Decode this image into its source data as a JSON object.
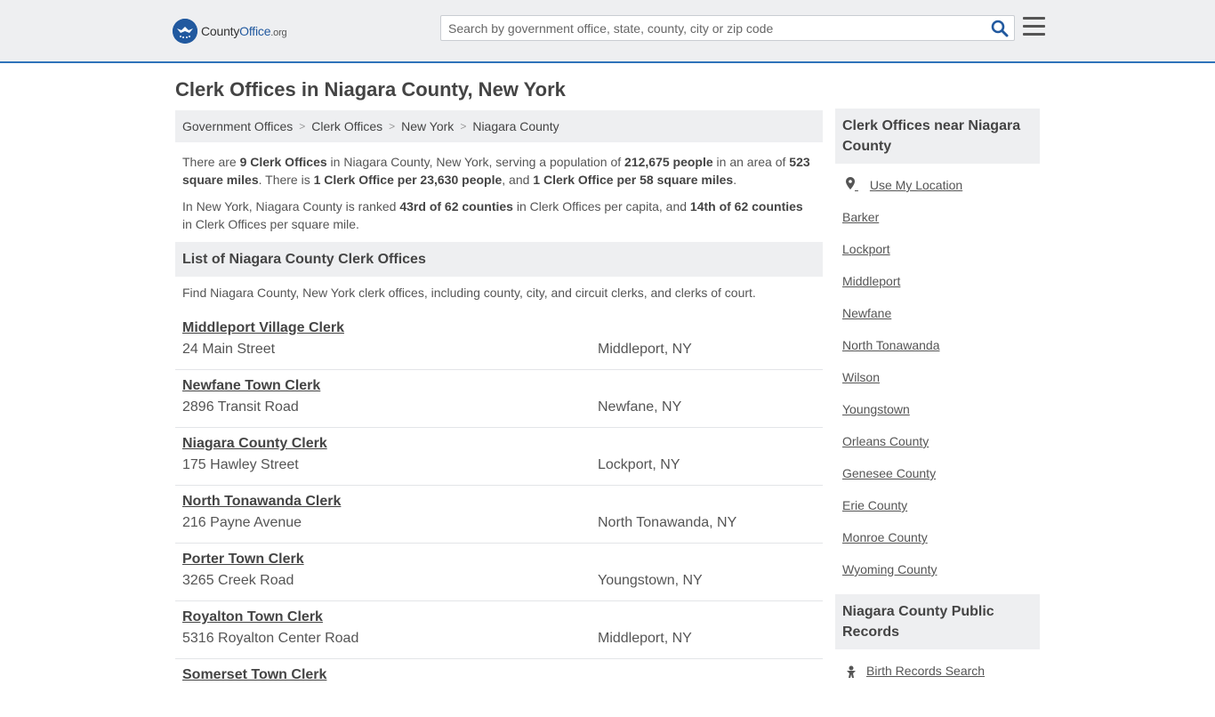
{
  "header": {
    "logo": {
      "brand": "County",
      "brand_accent": "Office",
      "tld": ".org"
    },
    "search": {
      "placeholder": "Search by government office, state, county, city or zip code"
    }
  },
  "page_title": "Clerk Offices in Niagara County, New York",
  "breadcrumb": [
    "Government Offices",
    "Clerk Offices",
    "New York",
    "Niagara County"
  ],
  "intro": {
    "p1": {
      "t1": "There are ",
      "b1": "9 Clerk Offices",
      "t2": " in Niagara County, New York, serving a population of ",
      "b2": "212,675 people",
      "t3": " in an area of ",
      "b3": "523 square miles",
      "t4": ". There is ",
      "b4": "1 Clerk Office per 23,630 people",
      "t5": ", and ",
      "b5": "1 Clerk Office per 58 square miles",
      "t6": "."
    },
    "p2": {
      "t1": "In New York, Niagara County is ranked ",
      "b1": "43rd of 62 counties",
      "t2": " in Clerk Offices per capita, and ",
      "b2": "14th of 62 counties",
      "t3": " in Clerk Offices per square mile."
    }
  },
  "list": {
    "heading": "List of Niagara County Clerk Offices",
    "description": "Find Niagara County, New York clerk offices, including county, city, and circuit clerks, and clerks of court.",
    "offices": [
      {
        "name": "Middleport Village Clerk",
        "address": "24 Main Street",
        "city": "Middleport, NY"
      },
      {
        "name": "Newfane Town Clerk",
        "address": "2896 Transit Road",
        "city": "Newfane, NY"
      },
      {
        "name": "Niagara County Clerk",
        "address": "175 Hawley Street",
        "city": "Lockport, NY"
      },
      {
        "name": "North Tonawanda Clerk",
        "address": "216 Payne Avenue",
        "city": "North Tonawanda, NY"
      },
      {
        "name": "Porter Town Clerk",
        "address": "3265 Creek Road",
        "city": "Youngstown, NY"
      },
      {
        "name": "Royalton Town Clerk",
        "address": "5316 Royalton Center Road",
        "city": "Middleport, NY"
      },
      {
        "name": "Somerset Town Clerk",
        "address": "",
        "city": ""
      }
    ]
  },
  "sidebar": {
    "nearby_title": "Clerk Offices near Niagara County",
    "use_location": "Use My Location",
    "nearby": [
      "Barker",
      "Lockport",
      "Middleport",
      "Newfane",
      "North Tonawanda",
      "Wilson",
      "Youngstown",
      "Orleans County",
      "Genesee County",
      "Erie County",
      "Monroe County",
      "Wyoming County"
    ],
    "records_title": "Niagara County Public Records",
    "records": [
      "Birth Records Search"
    ]
  },
  "colors": {
    "accent": "#2f73ba",
    "logo": "#21599f",
    "panel": "#eeeff1"
  }
}
